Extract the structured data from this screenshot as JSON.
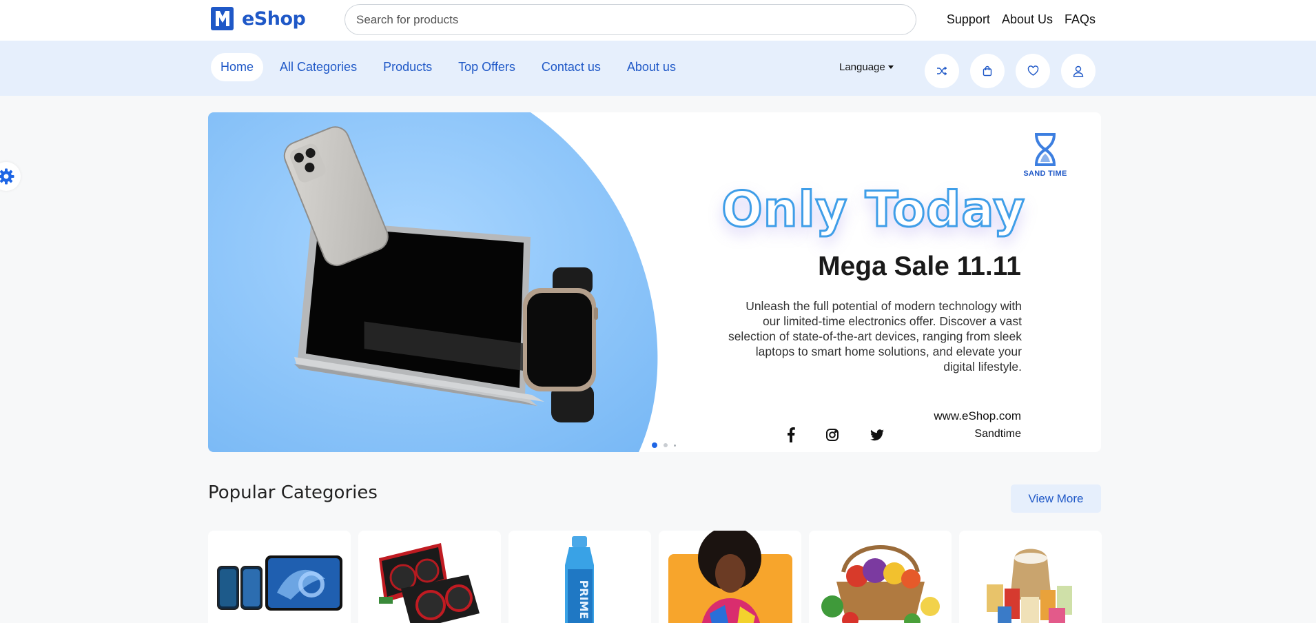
{
  "header": {
    "logo_text": "eShop",
    "search_placeholder": "Search for products",
    "links": [
      "Support",
      "About Us",
      "FAQs"
    ]
  },
  "nav": {
    "items": [
      "Home",
      "All Categories",
      "Products",
      "Top Offers",
      "Contact us",
      "About us"
    ],
    "active": "Home",
    "language_label": "Language",
    "icons": [
      "shuffle-icon",
      "bag-icon",
      "heart-icon",
      "user-icon"
    ]
  },
  "hero": {
    "brand_small": "SAND TIME",
    "title": "Only Today",
    "subtitle": "Mega Sale 11.11",
    "description": "Unleash the full potential of modern technology with our limited-time electronics offer. Discover a vast selection of state-of-the-art devices, ranging from sleek laptops to smart home solutions, and elevate your digital lifestyle.",
    "website": "www.eShop.com",
    "brand_name": "Sandtime",
    "social": [
      "facebook-icon",
      "instagram-icon",
      "twitter-icon"
    ],
    "slides_count": 3,
    "active_slide": 1
  },
  "popular_categories": {
    "title": "Popular Categories",
    "view_more_label": "View More",
    "cards": [
      "electronics",
      "graphics-cards",
      "drinks",
      "fashion",
      "fruits-vegetables",
      "groceries"
    ]
  },
  "colors": {
    "accent": "#1f58c7",
    "nav_bg": "#e6effc",
    "hero_blue": "#8ec5fa"
  }
}
